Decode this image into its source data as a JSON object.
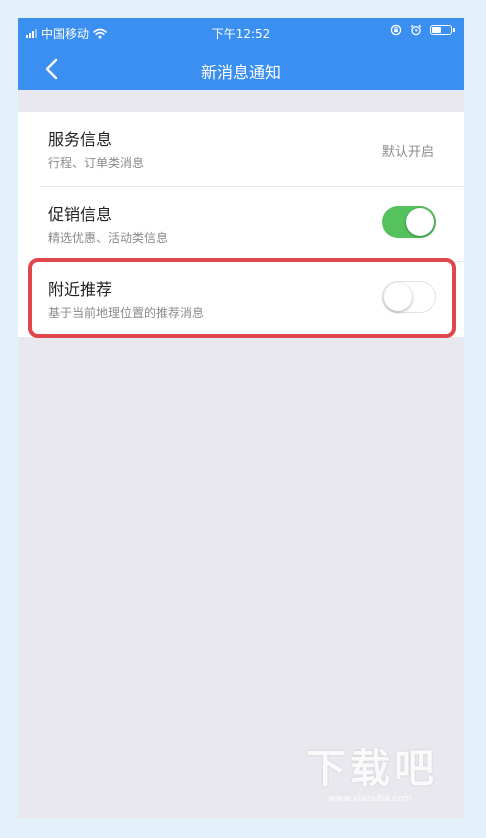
{
  "status_bar": {
    "carrier": "中国移动",
    "time": "下午12:52"
  },
  "nav": {
    "title": "新消息通知"
  },
  "rows": [
    {
      "title": "服务信息",
      "subtitle": "行程、订单类消息",
      "value": "默认开启"
    },
    {
      "title": "促销信息",
      "subtitle": "精选优惠、活动类信息",
      "toggle_on": true
    },
    {
      "title": "附近推荐",
      "subtitle": "基于当前地理位置的推荐消息",
      "toggle_on": false
    }
  ],
  "watermark": {
    "text": "下载吧",
    "url": "www.xiazaiba.com"
  },
  "colors": {
    "nav_blue": "#3a8ff0",
    "toggle_green": "#55c25d",
    "highlight_red": "#e0474c",
    "page_bg": "#e9e8ee"
  },
  "icons": [
    "signal-icon",
    "wifi-icon",
    "lock-rotation-icon",
    "alarm-icon",
    "battery-icon",
    "back-chevron-icon"
  ]
}
